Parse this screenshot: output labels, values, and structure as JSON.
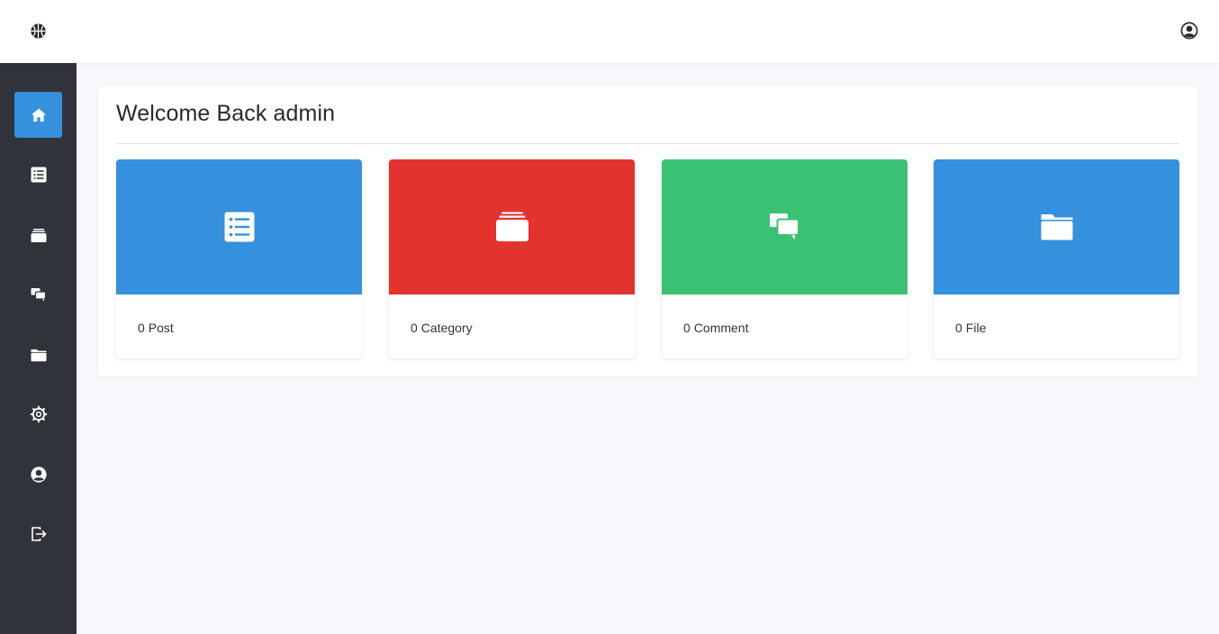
{
  "header": {
    "logo_icon": "basketball-icon",
    "user_icon": "user-circle-icon"
  },
  "sidebar": {
    "items": [
      {
        "icon": "home-icon",
        "active": true
      },
      {
        "icon": "list-icon",
        "active": false
      },
      {
        "icon": "layers-icon",
        "active": false
      },
      {
        "icon": "comments-icon",
        "active": false
      },
      {
        "icon": "folder-icon",
        "active": false
      },
      {
        "icon": "gear-icon",
        "active": false
      },
      {
        "icon": "user-circle-icon",
        "active": false
      },
      {
        "icon": "logout-icon",
        "active": false
      }
    ]
  },
  "main": {
    "welcome": "Welcome Back admin",
    "cards": [
      {
        "count": "0",
        "label": "Post",
        "color": "#3590dd",
        "icon": "list-icon"
      },
      {
        "count": "0",
        "label": "Category",
        "color": "#e2332f",
        "icon": "layers-icon"
      },
      {
        "count": "0",
        "label": "Comment",
        "color": "#3ac274",
        "icon": "comments-icon"
      },
      {
        "count": "0",
        "label": "File",
        "color": "#3590dd",
        "icon": "folder-icon"
      }
    ]
  },
  "colors": {
    "sidebar_bg": "#30343a",
    "active_nav": "#3590dd",
    "page_bg": "#f7f8fb"
  }
}
